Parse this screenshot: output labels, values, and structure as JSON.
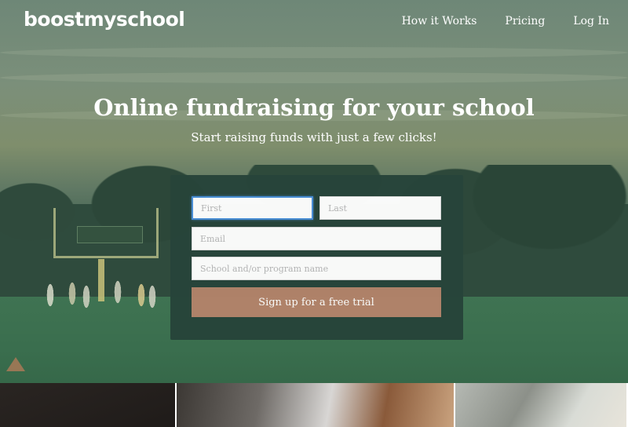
{
  "header": {
    "logo_text": "boostmyschool",
    "nav": [
      {
        "label": "How it Works"
      },
      {
        "label": "Pricing"
      },
      {
        "label": "Log In"
      }
    ]
  },
  "hero": {
    "headline": "Online fundraising for your school",
    "subheadline": "Start raising funds with just a few clicks!"
  },
  "signup_form": {
    "first_placeholder": "First",
    "first_value": "",
    "last_placeholder": "Last",
    "last_value": "",
    "email_placeholder": "Email",
    "email_value": "",
    "school_placeholder": "School and/or program name",
    "school_value": "",
    "submit_label": "Sign up for a free trial"
  },
  "colors": {
    "panel_bg": "#27443a",
    "button_bg": "#b3836a",
    "focus_ring": "#4a90d9"
  }
}
